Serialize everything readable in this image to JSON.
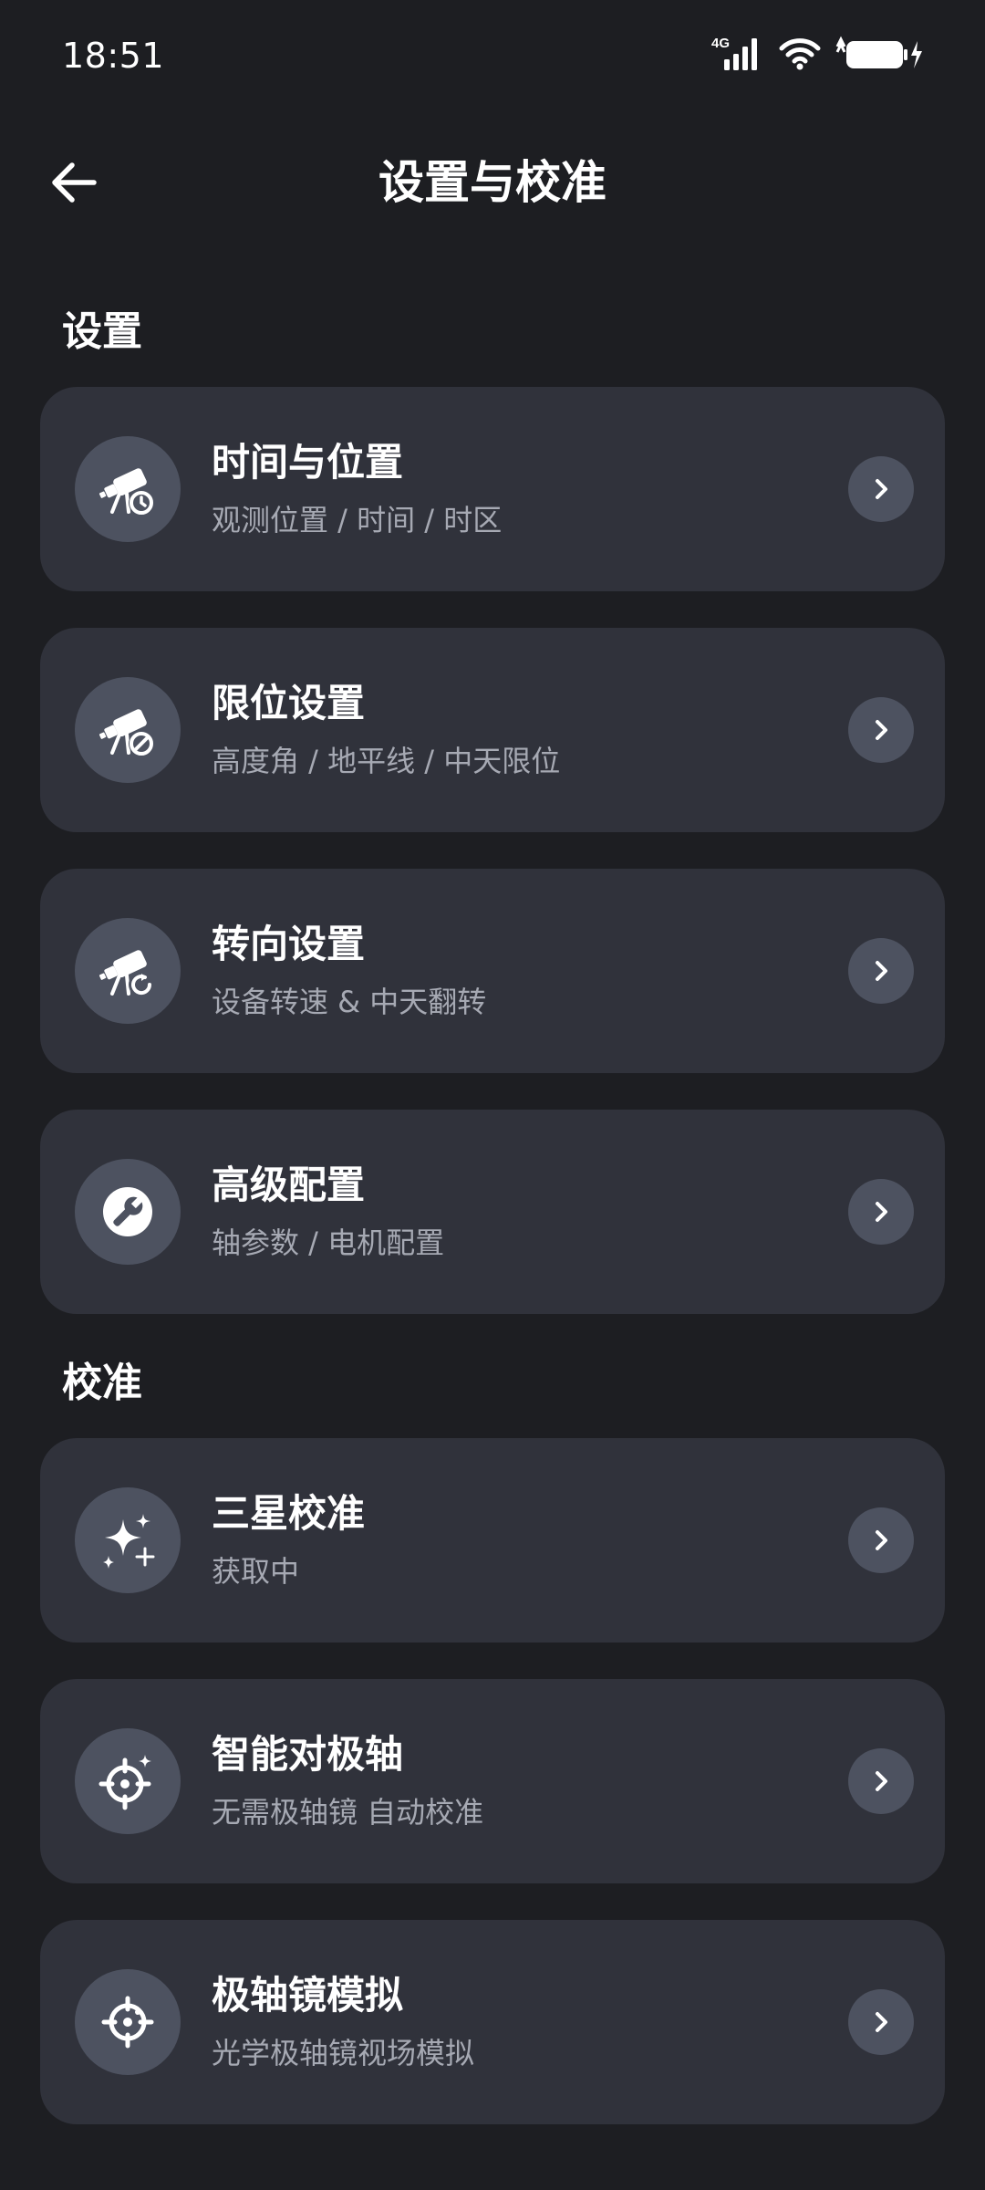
{
  "status_bar": {
    "time": "18:51",
    "network": "4G"
  },
  "header": {
    "title": "设置与校准"
  },
  "sections": [
    {
      "label": "设置",
      "items": [
        {
          "title": "时间与位置",
          "subtitle": "观测位置 / 时间 / 时区",
          "icon": "telescope-clock-icon"
        },
        {
          "title": "限位设置",
          "subtitle": "高度角 / 地平线 / 中天限位",
          "icon": "telescope-limit-icon"
        },
        {
          "title": "转向设置",
          "subtitle": "设备转速 & 中天翻转",
          "icon": "telescope-rotate-icon"
        },
        {
          "title": "高级配置",
          "subtitle": "轴参数 / 电机配置",
          "icon": "wrench-icon"
        }
      ]
    },
    {
      "label": "校准",
      "items": [
        {
          "title": "三星校准",
          "subtitle": "获取中",
          "icon": "sparkle-icon"
        },
        {
          "title": "智能对极轴",
          "subtitle": "无需极轴镜 自动校准",
          "icon": "smart-crosshair-icon"
        },
        {
          "title": "极轴镜模拟",
          "subtitle": "光学极轴镜视场模拟",
          "icon": "crosshair-icon"
        }
      ]
    }
  ],
  "colors": {
    "background": "#1d1e22",
    "card": "#30323b",
    "icon_circle": "#4d5260",
    "subtitle": "#a6a9b3"
  }
}
